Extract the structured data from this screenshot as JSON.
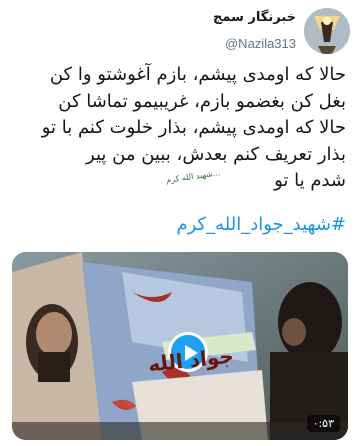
{
  "tweet": {
    "display_name": "خبرنگار سمج",
    "handle": "@Nazila313",
    "text_lines": [
      "حالا که اومدی پیشم، بازم آغوشتو وا کن",
      "بغل کن بغضمو بازم، غریبیمو تماشا کن",
      "حالا که اومدی پیشم، بذار خلوت کنم با تو",
      "بذار تعریف کنم بعدش، ببین من پیر",
      "شدم یا تو"
    ],
    "hashtag": "#شهید_جواد_الله_کرم"
  },
  "media": {
    "duration": "۰:۵۳",
    "poster_caption": "جواد الله",
    "poster_small_text": "...شهید الله کرم",
    "play_icon": "play-icon"
  },
  "colors": {
    "accent": "#1da1f2",
    "hashtag": "#1b95e0",
    "text": "#14171a",
    "muted": "#657786"
  }
}
